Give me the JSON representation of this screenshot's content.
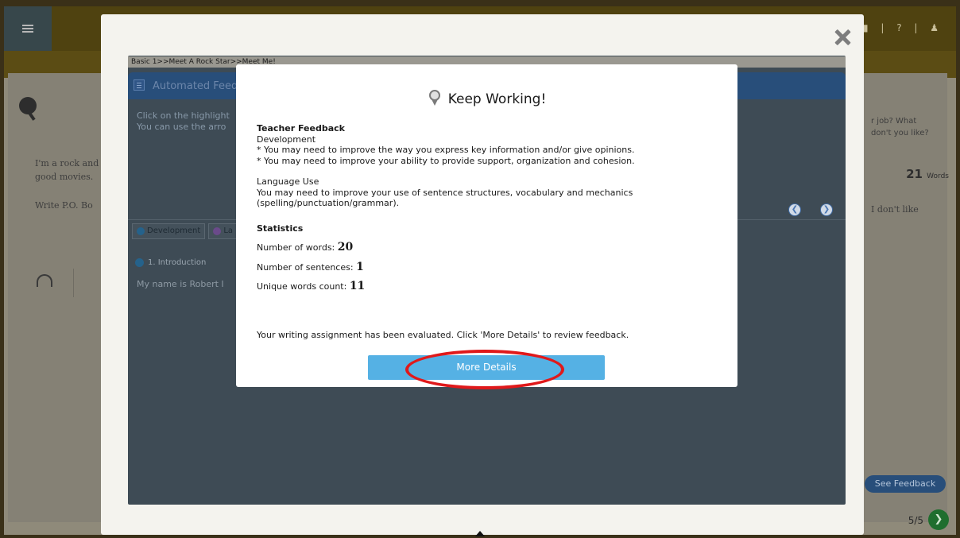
{
  "background": {
    "top_icons": "■ | ? | ♟",
    "rock_text_line1": "I'm a rock and",
    "rock_text_line2": "good movies.",
    "write_line": "Write P.O. Bo",
    "side_question_1": "r job? What",
    "side_question_2": "don't you like?",
    "side_text_dont_like": "I don't like",
    "words_count": "21",
    "words_label": "Words",
    "see_feedback": "See Feedback",
    "page_indicator": "5/5"
  },
  "inner": {
    "breadcrumb": "Basic 1>>Meet A Rock Star>>Meet Me!",
    "panel_title": "Automated Feed",
    "instruction_1": "Click on the highlight",
    "instruction_2": "You can use the arro",
    "tab_development": "Development",
    "tab_language": "La",
    "intro_label": "1. Introduction",
    "essay_start": "My name is Robert I"
  },
  "dialog": {
    "title": "Keep Working!",
    "teacher_feedback_heading": "Teacher Feedback",
    "development_label": "Development",
    "dev_point_1": "* You may need to improve the way you express key information and/or give opinions.",
    "dev_point_2": "* You may need to improve your ability to provide support, organization and cohesion.",
    "language_use_label": "Language Use",
    "language_point_1": "You may need to improve your use of sentence structures, vocabulary and mechanics",
    "language_point_2": "(spelling/punctuation/grammar).",
    "statistics_heading": "Statistics",
    "words_label": "Number of words:",
    "words_value": "20",
    "sentences_label": "Number of sentences:",
    "sentences_value": "1",
    "unique_label": "Unique words count:",
    "unique_value": "11",
    "footer_message": "Your writing assignment has been evaluated. Click 'More Details' to review feedback.",
    "more_details_button": "More Details"
  },
  "colors": {
    "button_blue": "#55b1e4",
    "highlight_red": "#e0191b",
    "panel_header": "#284e7a"
  }
}
